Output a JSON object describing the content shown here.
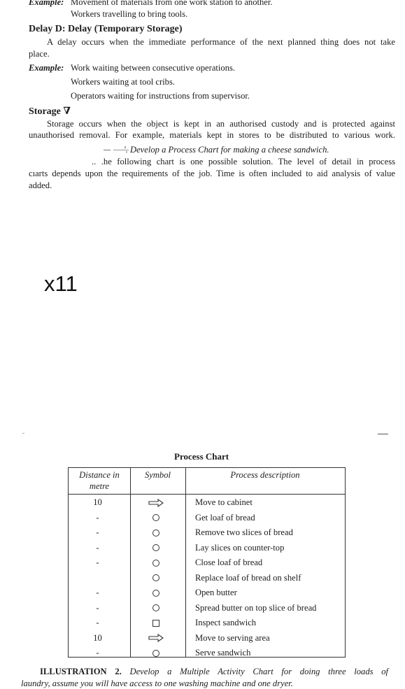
{
  "text": {
    "example1_label": "Example:",
    "example1_line1": "Movement of materials from one work station to another.",
    "example1_line2": "Workers travelling to bring tools.",
    "delay_heading": "Delay D: Delay (Temporary Storage)",
    "delay_para_line1": "A delay occurs when the immediate performance of the next planned thing does not take",
    "delay_para_line2": "place.",
    "example2_label": "Example:",
    "example2_line1": "Work waiting between consecutive operations.",
    "example2_line2": "Workers waiting at tool cribs.",
    "example2_line3": "Operators waiting for instructions from supervisor.",
    "storage_heading": "Storage",
    "storage_symbol": "∇",
    "storage_para_line1": "Storage occurs when the object is kept in an authorised custody and is protected against",
    "storage_para_line2": "unauthorised removal. For example, materials kept in stores to be distributed to various work.",
    "illustration1_fragment": "'. Develop a Process Chart for making a cheese sandwich.",
    "solution_line1": ".. .he following chart is one possible solution. The level of detail in process",
    "solution_line2": "cıarts depends upon the requirements of the job. Time is often included to aid analysis of value",
    "solution_line3": "added.",
    "zoom_overlay": "x11"
  },
  "process_chart": {
    "title": "Process Chart",
    "headers": {
      "distance_line1": "Distance in",
      "distance_line2": "metre",
      "symbol": "Symbol",
      "description": "Process description"
    },
    "rows": [
      {
        "distance": "10",
        "symbol": "arrow-icon",
        "description": "Move to cabinet"
      },
      {
        "distance": "-",
        "symbol": "circle-icon",
        "description": "Get loaf of bread"
      },
      {
        "distance": "-",
        "symbol": "circle-icon",
        "description": "Remove two slices of bread"
      },
      {
        "distance": "-",
        "symbol": "circle-icon",
        "description": "Lay slices on counter-top"
      },
      {
        "distance": "-",
        "symbol": "circle-icon",
        "description": "Close loaf of bread"
      },
      {
        "distance": "",
        "symbol": "circle-icon",
        "description": "Replace loaf of bread on shelf"
      },
      {
        "distance": "-",
        "symbol": "circle-icon",
        "description": "Open butter"
      },
      {
        "distance": "-",
        "symbol": "circle-icon",
        "description": "Spread butter on top slice of bread"
      },
      {
        "distance": "-",
        "symbol": "square-icon",
        "description": "Inspect sandwich"
      },
      {
        "distance": "10",
        "symbol": "arrow-icon",
        "description": "Move to serving area"
      },
      {
        "distance": "-",
        "symbol": "circle-icon",
        "description": "Serve sandwich"
      }
    ]
  },
  "illustration2": {
    "label": "ILLUSTRATION 2.",
    "text_line1": "Develop a Multiple Activity Chart for doing three loads of",
    "text_line2": "laundry, assume you will have access to one washing machine and one dryer."
  }
}
